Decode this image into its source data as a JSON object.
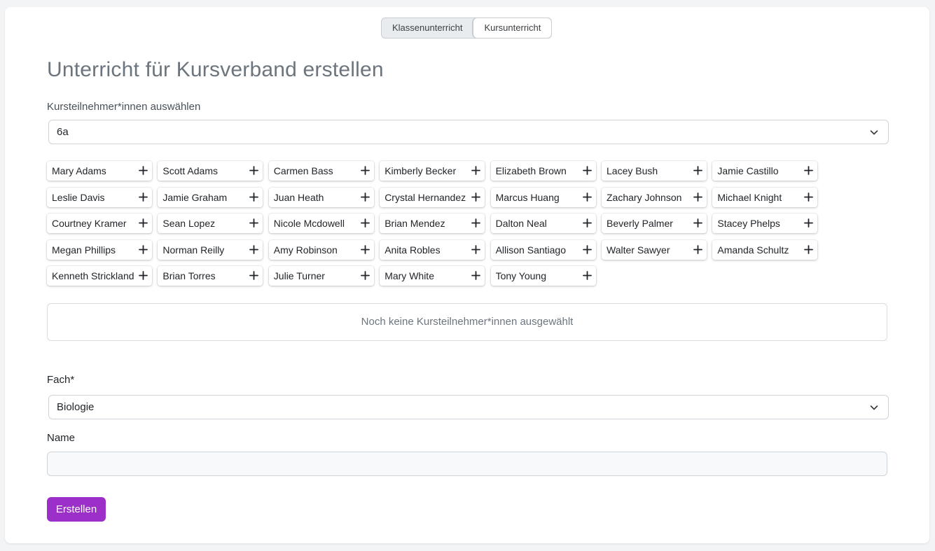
{
  "mode_toggle": {
    "options": [
      "Klassenunterricht",
      "Kursunterricht"
    ],
    "selected": "Kursunterricht"
  },
  "title": "Unterricht für Kursverband erstellen",
  "participants": {
    "label": "Kursteilnehmer*innen auswählen",
    "class_select_value": "6a",
    "students": [
      "Mary Adams",
      "Scott Adams",
      "Carmen Bass",
      "Kimberly Becker",
      "Elizabeth Brown",
      "Lacey Bush",
      "Jamie Castillo",
      "Leslie Davis",
      "Jamie Graham",
      "Juan Heath",
      "Crystal Hernandez",
      "Marcus Huang",
      "Zachary Johnson",
      "Michael Knight",
      "Courtney Kramer",
      "Sean Lopez",
      "Nicole Mcdowell",
      "Brian Mendez",
      "Dalton Neal",
      "Beverly Palmer",
      "Stacey Phelps",
      "Megan Phillips",
      "Norman Reilly",
      "Amy Robinson",
      "Anita Robles",
      "Allison Santiago",
      "Walter Sawyer",
      "Amanda Schultz",
      "Kenneth Strickland",
      "Brian Torres",
      "Julie Turner",
      "Mary White",
      "Tony Young"
    ],
    "empty_message": "Noch keine Kursteilnehmer*innen ausgewählt"
  },
  "subject": {
    "label": "Fach*",
    "value": "Biologie"
  },
  "name": {
    "label": "Name",
    "value": ""
  },
  "submit_label": "Erstellen",
  "colors": {
    "primary": "#9c2fc7",
    "title_gray": "#6c757d"
  }
}
